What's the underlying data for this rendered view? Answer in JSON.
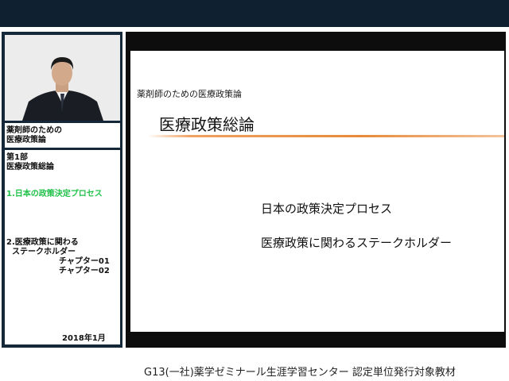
{
  "sidebar": {
    "course_title_line1": "薬剤師のための",
    "course_title_line2": "医療政策論",
    "part_line1": "第1部",
    "part_line2": "医療政策総論",
    "item1": "1.日本の政策決定プロセス",
    "item2_line1": "2.医療政策に関わる",
    "item2_line2": "  ステークホルダー",
    "chapter1": "チャプター01",
    "chapter2": "チャプター02",
    "date": "2018年1月"
  },
  "slide": {
    "subtitle": "薬剤師のための医療政策論",
    "title": "医療政策総論",
    "items": [
      "日本の政策決定プロセス",
      "医療政策に関わるステークホルダー"
    ]
  },
  "footer": {
    "text": "G13(一社)薬学ゼミナール生涯学習センター 認定単位発行対象教材"
  },
  "colors": {
    "frame": "#14283a",
    "active_item": "#22c14a",
    "accent_rule": "#e88a3a"
  }
}
